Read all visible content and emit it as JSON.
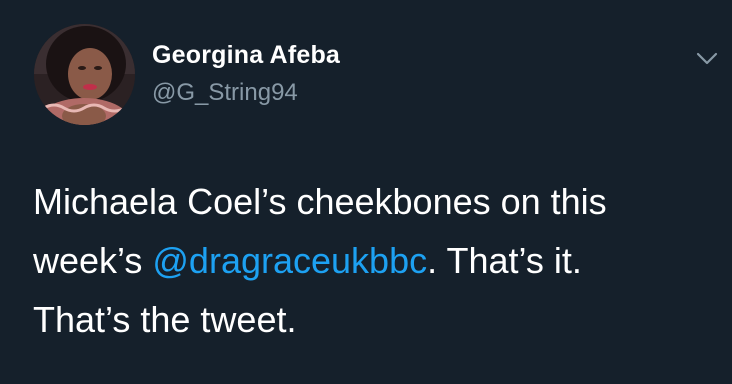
{
  "tweet": {
    "display_name": "Georgina Afeba",
    "handle": "@G_String94",
    "body": {
      "line1": "Michaela Coel’s cheekbones on this",
      "line2_before": "week’s ",
      "mention": "@dragraceukbbc",
      "line2_after": ". That’s it.",
      "line3": "That’s the tweet."
    },
    "icons": {
      "avatar": "profile-photo",
      "menu": "chevron-down-icon"
    },
    "colors": {
      "background": "#15202b",
      "text": "#ffffff",
      "secondary": "#8899a6",
      "link": "#1da1f2"
    }
  }
}
